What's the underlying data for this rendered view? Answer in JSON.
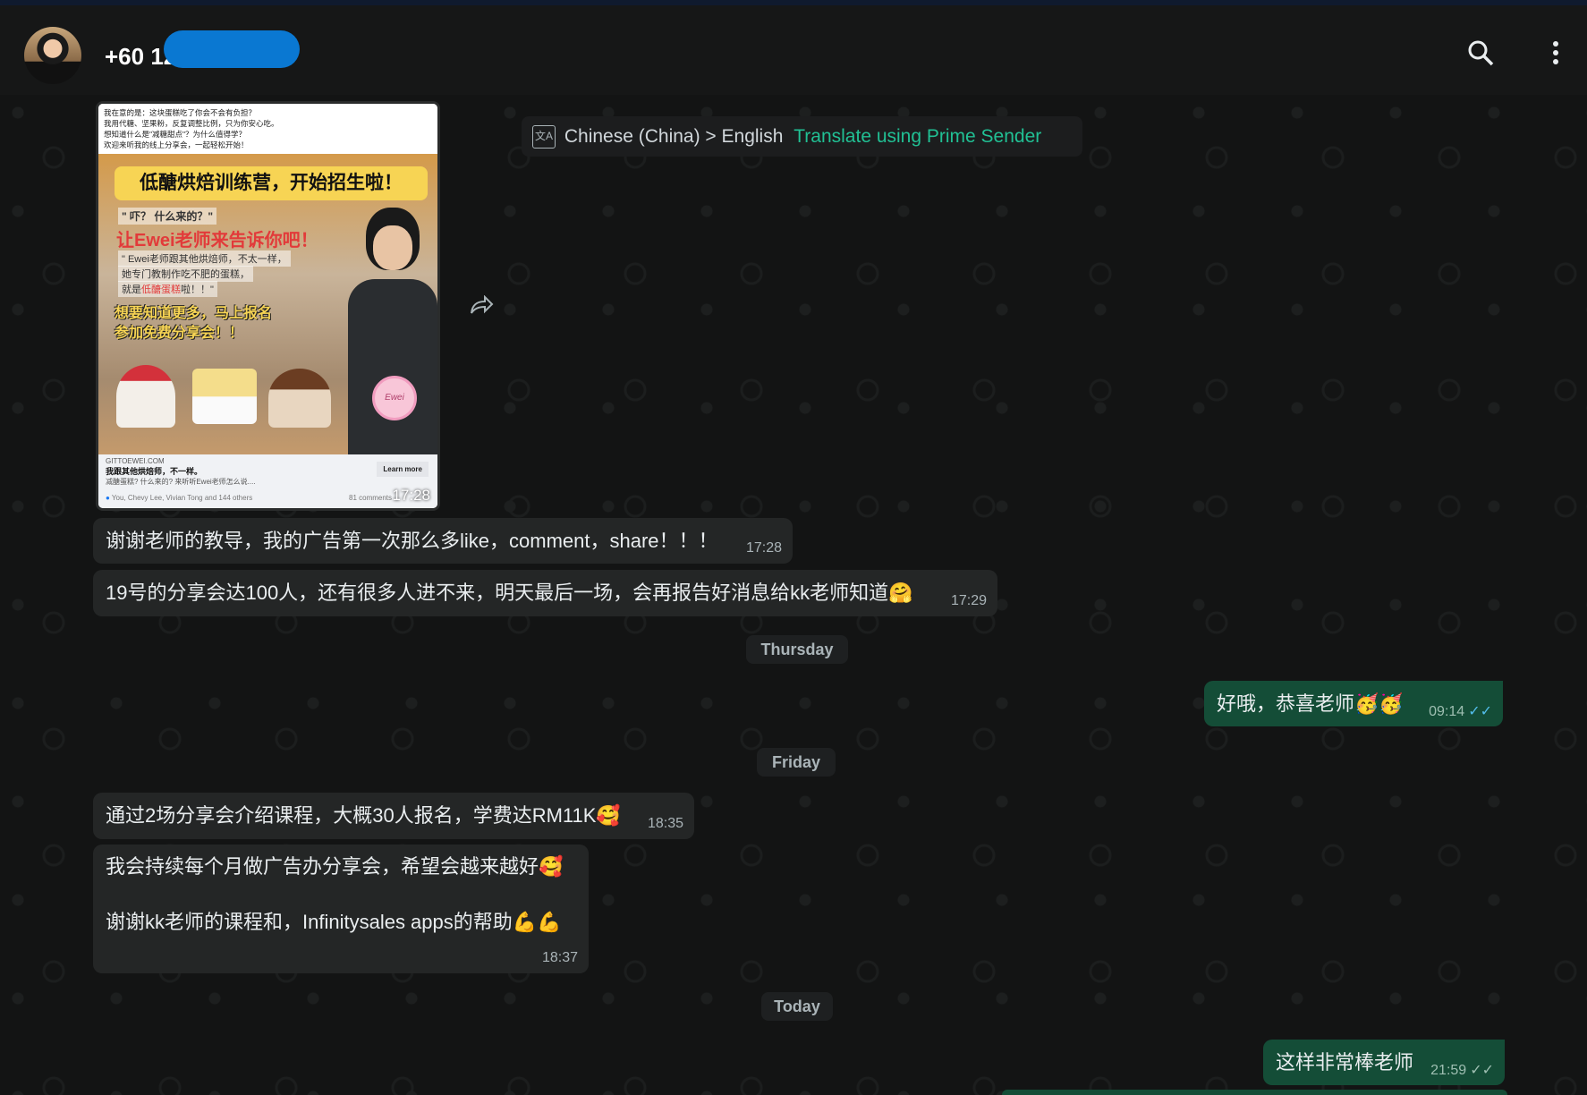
{
  "header": {
    "contact": "+60 12",
    "icons": [
      "search-icon",
      "more-vertical-icon"
    ]
  },
  "translate_bar": {
    "languages": "Chinese (China) > English",
    "action": "Translate using Prime Sender"
  },
  "image_message": {
    "caption_lines": [
      "我在意的是：这块蛋糕吃了你会不会有负担？",
      "我用代糖、坚果粉，反复调整比例，只为你安心吃。",
      "想知道什么是\"减糖甜点\"？为什么值得学？",
      "欢迎来听我的线上分享会，一起轻松开始！"
    ],
    "banner": "低醣烘焙训练营，开始招生啦！",
    "line1": "\" 吓？ 什么来的？\"",
    "line2": "让Ewei老师来告诉你吧！",
    "line3": "\" Ewei老师跟其他烘焙师，不太一样，",
    "line4": "她专门教制作吃不肥的蛋糕，",
    "line5a": "就是",
    "line5b": "低醣蛋糕",
    "line5c": "啦！！\"",
    "line6": "想要知道更多，马上报名",
    "line7": "参加免费分享会！！",
    "logo": "Ewei",
    "domain": "GITTOEWEI.COM",
    "headline": "我跟其他烘焙师，不一样。",
    "sub": "减醣蛋糕? 什么来的? 来听听Ewei老师怎么说....",
    "cta": "Learn more",
    "reactions": "You, Chevy Lee, Vivian Tong and 144 others",
    "comments": "81 comments",
    "time": "17:28"
  },
  "messages": [
    {
      "text": "谢谢老师的教导，我的广告第一次那么多like，comment，share！！！",
      "time": "17:28"
    },
    {
      "text": "19号的分享会达100人，还有很多人进不来，明天最后一场，会再报告好消息给kk老师知道🤗",
      "time": "17:29"
    },
    {
      "text": "好哦，恭喜老师🥳🥳",
      "time": "09:14",
      "status": "read"
    },
    {
      "text": "通过2场分享会介绍课程，大概30人报名，学费达RM11K🥰",
      "time": "18:35"
    },
    {
      "text": "我会持续每个月做广告办分享会，希望会越来越好🥰",
      "text2": "谢谢kk老师的课程和，Infinitysales apps的帮助💪💪",
      "time": "18:37"
    },
    {
      "text": "这样非常棒老师",
      "time": "21:59",
      "status": "delivered"
    }
  ],
  "dates": [
    "Thursday",
    "Friday",
    "Today"
  ],
  "colors": {
    "accent": "#21c094",
    "outgoing": "#144d37",
    "incoming": "#242626",
    "read_ticks": "#53bdeb"
  }
}
